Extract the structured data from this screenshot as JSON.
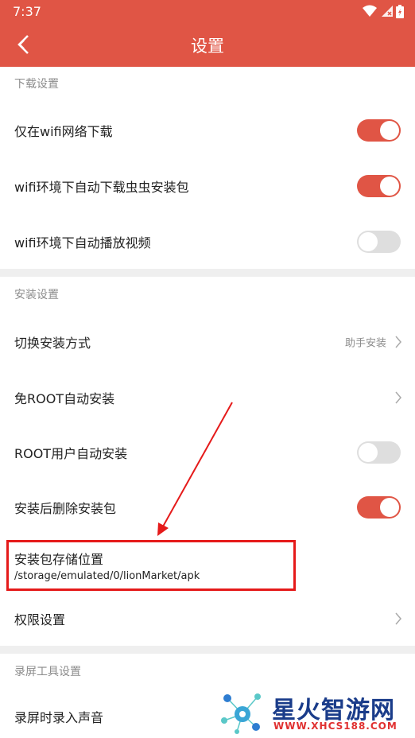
{
  "status_bar": {
    "time": "7:37"
  },
  "app_bar": {
    "title": "设置"
  },
  "sections": {
    "download": {
      "title": "下载设置"
    },
    "install": {
      "title": "安装设置"
    },
    "record": {
      "title": "录屏工具设置"
    }
  },
  "rows": {
    "wifi_only": {
      "label": "仅在wifi网络下载",
      "toggle": "on"
    },
    "wifi_auto_download": {
      "label": "wifi环境下自动下载虫虫安装包",
      "toggle": "on"
    },
    "wifi_autoplay": {
      "label": "wifi环境下自动播放视频",
      "toggle": "off"
    },
    "install_method": {
      "label": "切换安装方式",
      "value": "助手安装"
    },
    "root_free_install": {
      "label": "免ROOT自动安装"
    },
    "root_auto_install": {
      "label": "ROOT用户自动安装",
      "toggle": "off"
    },
    "delete_after_install": {
      "label": "安装后删除安装包",
      "toggle": "on"
    },
    "storage_location": {
      "label": "安装包存储位置",
      "path": "/storage/emulated/0/lionMarket/apk"
    },
    "permissions": {
      "label": "权限设置"
    },
    "record_audio": {
      "label": "录屏时录入声音"
    }
  },
  "watermark": {
    "name": "星火智游网",
    "url": "WWW.XHCS188.COM"
  },
  "colors": {
    "accent": "#e05545",
    "highlight": "#e51a1a"
  }
}
